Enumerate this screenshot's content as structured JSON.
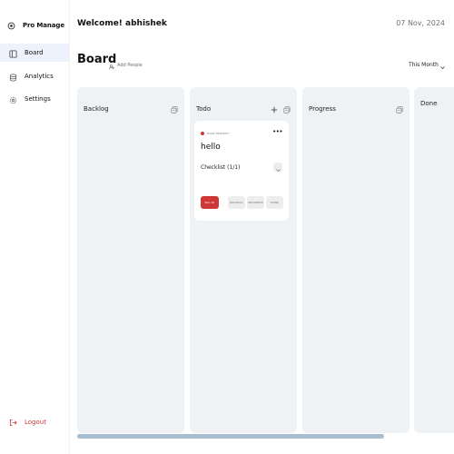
{
  "sidebar": {
    "brand": "Pro Manage",
    "items": [
      {
        "label": "Board"
      },
      {
        "label": "Analytics"
      },
      {
        "label": "Settings"
      }
    ],
    "logout": "Logout"
  },
  "header": {
    "welcome": "Welcome! abhishek",
    "date": "07 Nov, 2024",
    "board_title": "Board",
    "add_people": "Add People",
    "period": "This Month"
  },
  "columns": [
    {
      "title": "Backlog"
    },
    {
      "title": "Todo"
    },
    {
      "title": "Progress"
    },
    {
      "title": "Done"
    }
  ],
  "card": {
    "priority": "HIGH PRIORITY",
    "title": "hello",
    "checklist": "Checklist (1/1)",
    "due": "Nov 10",
    "actions": [
      "BACKLOG",
      "PROGRESS",
      "DONE"
    ]
  },
  "colors": {
    "accent": "#cf3636",
    "column_bg": "#eef2f5",
    "active_nav": "#eef2fc",
    "scrollbar": "#a8bdd0"
  }
}
